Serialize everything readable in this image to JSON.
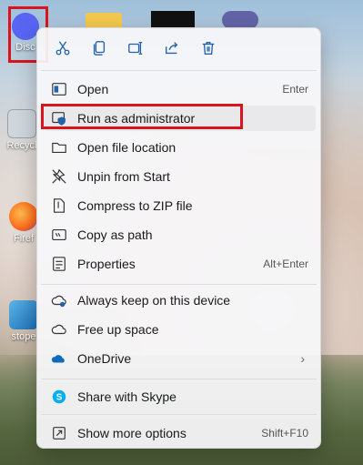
{
  "desktop": {
    "icons": [
      {
        "label": "Disc"
      },
      {
        "label": "Recycl"
      },
      {
        "label": "Firef"
      },
      {
        "label": "stope"
      }
    ]
  },
  "menu": {
    "toolbar": {
      "cut": "cut-icon",
      "copy": "copy-icon",
      "rename": "rename-icon",
      "share": "share-icon",
      "delete": "delete-icon"
    },
    "items": [
      {
        "label": "Open",
        "shortcut": "Enter"
      },
      {
        "label": "Run as administrator",
        "shortcut": ""
      },
      {
        "label": "Open file location",
        "shortcut": ""
      },
      {
        "label": "Unpin from Start",
        "shortcut": ""
      },
      {
        "label": "Compress to ZIP file",
        "shortcut": ""
      },
      {
        "label": "Copy as path",
        "shortcut": ""
      },
      {
        "label": "Properties",
        "shortcut": "Alt+Enter"
      },
      {
        "label": "Always keep on this device",
        "shortcut": ""
      },
      {
        "label": "Free up space",
        "shortcut": ""
      },
      {
        "label": "OneDrive",
        "submenu": "›"
      },
      {
        "label": "Share with Skype",
        "shortcut": ""
      },
      {
        "label": "Show more options",
        "shortcut": "Shift+F10"
      }
    ]
  },
  "colors": {
    "accent": "#2563a8",
    "highlight": "#d9141c",
    "discord": "#5865f2",
    "onedrive": "#0f6cbd",
    "skype": "#00aff0"
  }
}
